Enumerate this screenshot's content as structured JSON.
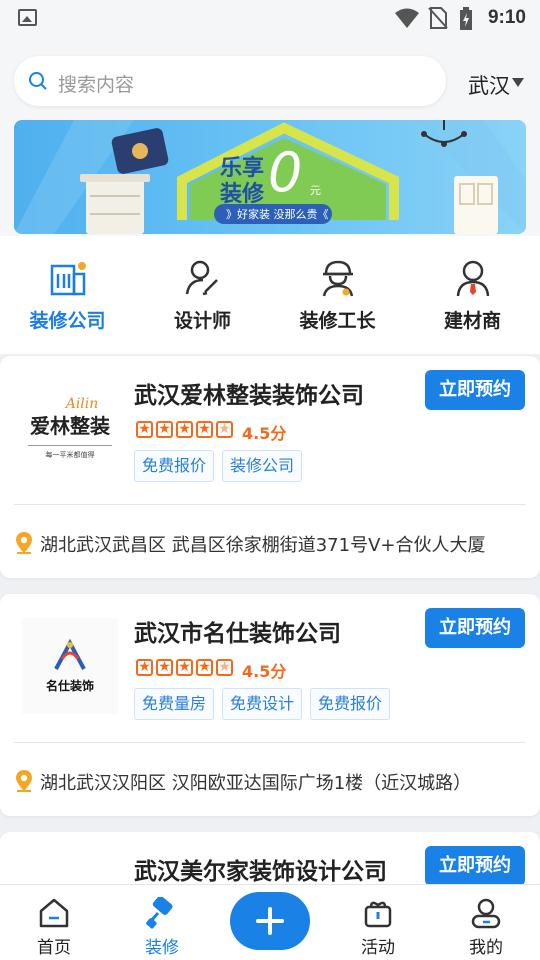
{
  "status_bar": {
    "time": "9:10"
  },
  "search": {
    "placeholder": "搜索内容"
  },
  "city": {
    "label": "武汉"
  },
  "banner": {
    "headline_1": "乐享",
    "headline_2": "装修",
    "price": "0",
    "price_unit": "元",
    "slogan": "》好家装 没那么贵《"
  },
  "categories": [
    {
      "label": "装修公司",
      "icon": "building-icon",
      "active": true
    },
    {
      "label": "设计师",
      "icon": "designer-icon",
      "active": false
    },
    {
      "label": "装修工长",
      "icon": "foreman-icon",
      "active": false
    },
    {
      "label": "建材商",
      "icon": "supplier-icon",
      "active": false
    }
  ],
  "companies": [
    {
      "name": "武汉爱林整装装饰公司",
      "logo_text": "爱林整装",
      "logo_script": "Ailin",
      "logo_sub": "每一平米都值得",
      "rating": 4.5,
      "rating_text": "4.5分",
      "tags": [
        "免费报价",
        "装修公司"
      ],
      "address": "湖北武汉武昌区 武昌区徐家棚街道371号V+合伙人大厦",
      "book_label": "立即预约"
    },
    {
      "name": "武汉市名仕装饰公司",
      "logo_text": "名仕装饰",
      "rating": 4.5,
      "rating_text": "4.5分",
      "tags": [
        "免费量房",
        "免费设计",
        "免费报价"
      ],
      "address": "湖北武汉汉阳区 汉阳欧亚达国际广场1楼（近汉城路）",
      "book_label": "立即预约"
    },
    {
      "name": "武汉美尔家装饰设计公司",
      "book_label": "立即预约"
    }
  ],
  "tabbar": [
    {
      "label": "首页",
      "icon": "home-icon",
      "active": false
    },
    {
      "label": "装修",
      "icon": "paint-roller-icon",
      "active": true
    },
    {
      "label": "",
      "icon": "plus-icon",
      "active": false
    },
    {
      "label": "活动",
      "icon": "gift-icon",
      "active": false
    },
    {
      "label": "我的",
      "icon": "profile-icon",
      "active": false
    }
  ],
  "colors": {
    "accent": "#1a82e6",
    "star": "#f46a1c",
    "location": "#f5a623"
  }
}
